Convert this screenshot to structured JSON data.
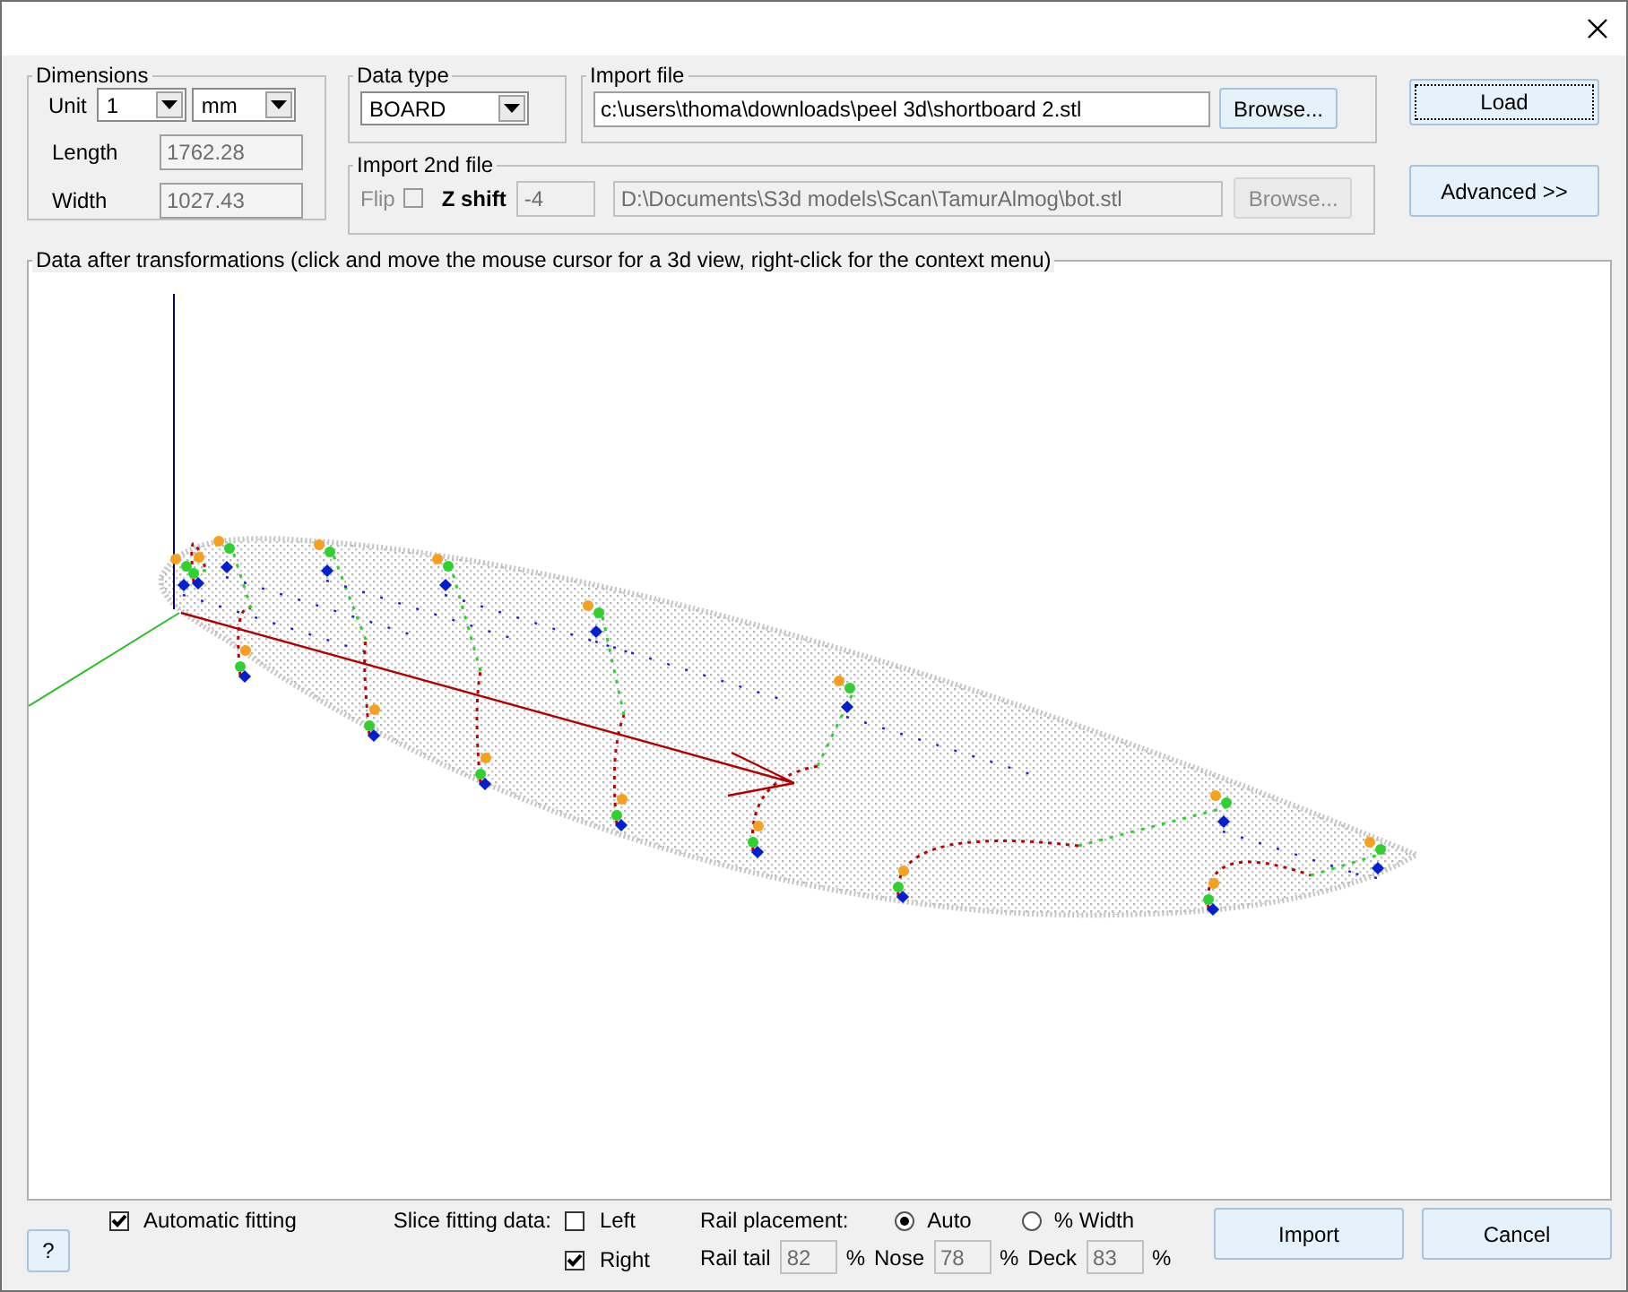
{
  "dimensions": {
    "title": "Dimensions",
    "unit_label": "Unit",
    "unit_value": "1",
    "unit_dropdown": "mm",
    "length_label": "Length",
    "length_value": "1762.28",
    "width_label": "Width",
    "width_value": "1027.43"
  },
  "data_type": {
    "title": "Data type",
    "value": "BOARD"
  },
  "import_file": {
    "title": "Import file",
    "path": "c:\\users\\thoma\\downloads\\peel 3d\\shortboard 2.stl",
    "browse": "Browse..."
  },
  "import_2nd_file": {
    "title": "Import 2nd file",
    "disabled": true,
    "flip_label": "Flip",
    "flip_checked": false,
    "zshift_label": "Z shift",
    "zshift_value": "-4",
    "path": "D:\\Documents\\S3d models\\Scan\\TamurAlmog\\bot.stl",
    "browse": "Browse..."
  },
  "side_buttons": [
    {
      "label": "Load",
      "focused": true
    },
    {
      "label": "Advanced >>",
      "focused": false
    }
  ],
  "view": {
    "title": "Data after transformations (click and move the mouse cursor for a 3d view, right-click for the context menu)"
  },
  "help_button": "?",
  "automatic_fitting": {
    "label": "Automatic fitting",
    "checked": true
  },
  "slice_fitting": {
    "label": "Slice fitting data:",
    "options": [
      {
        "label": "Left",
        "checked": false
      },
      {
        "label": "Right",
        "checked": true
      }
    ]
  },
  "rail_placement": {
    "label": "Rail placement:",
    "options": [
      {
        "label": "Auto",
        "selected": true
      },
      {
        "label": "% Width",
        "selected": false
      }
    ],
    "fields": [
      {
        "label": "Rail tail",
        "value": "82",
        "unit": "%"
      },
      {
        "label": "Nose",
        "value": "78",
        "unit": "%"
      },
      {
        "label": "Deck",
        "value": "83",
        "unit": "%"
      }
    ]
  },
  "actions": [
    "Import",
    "Cancel"
  ]
}
